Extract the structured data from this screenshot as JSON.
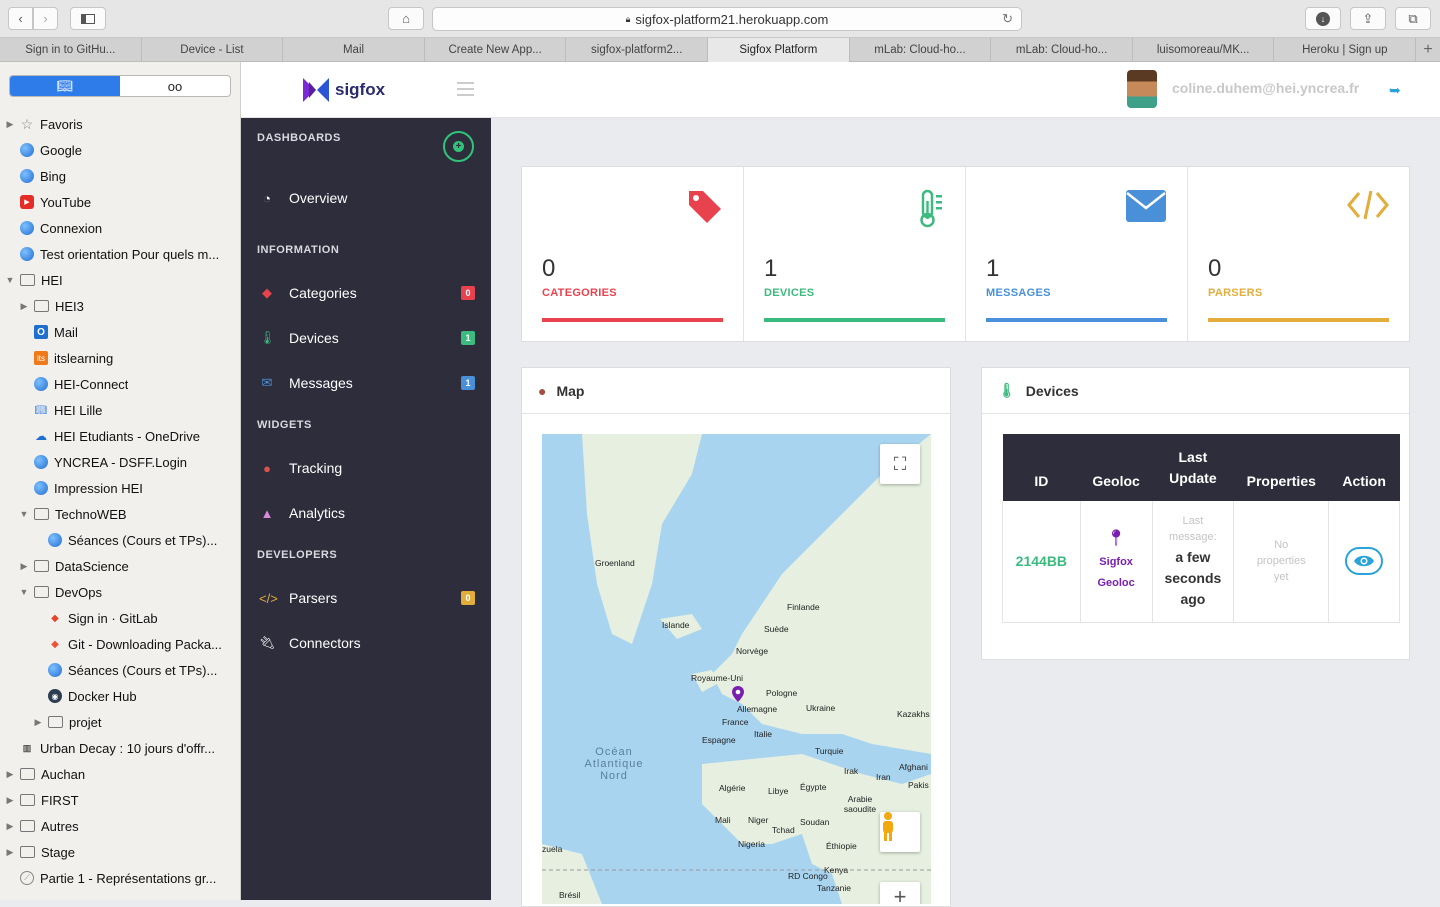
{
  "browser": {
    "url": "sigfox-platform21.herokuapp.com",
    "tabs": [
      "Sign in to GitHu...",
      "Device - List",
      "Mail",
      "Create New App...",
      "sigfox-platform2...",
      "Sigfox Platform",
      "mLab: Cloud-ho...",
      "mLab: Cloud-ho...",
      "luisomoreau/MK...",
      "Heroku | Sign up"
    ],
    "active_tab": 5
  },
  "bookmarks": [
    {
      "label": "Favoris",
      "icon": "star",
      "level": 0,
      "arrow": "▶"
    },
    {
      "label": "Google",
      "icon": "globe",
      "level": 0,
      "arrow": ""
    },
    {
      "label": "Bing",
      "icon": "globe",
      "level": 0,
      "arrow": ""
    },
    {
      "label": "YouTube",
      "icon": "youtube",
      "level": 0,
      "arrow": ""
    },
    {
      "label": "Connexion",
      "icon": "globe",
      "level": 0,
      "arrow": ""
    },
    {
      "label": "Test orientation Pour quels m...",
      "icon": "globe",
      "level": 0,
      "arrow": ""
    },
    {
      "label": "HEI",
      "icon": "folder",
      "level": 0,
      "arrow": "▼"
    },
    {
      "label": "HEI3",
      "icon": "folder",
      "level": 1,
      "arrow": "▶"
    },
    {
      "label": "Mail",
      "icon": "outlook",
      "level": 1,
      "arrow": ""
    },
    {
      "label": "itslearning",
      "icon": "its",
      "level": 1,
      "arrow": ""
    },
    {
      "label": "HEI-Connect",
      "icon": "globe",
      "level": 1,
      "arrow": ""
    },
    {
      "label": "HEI Lille",
      "icon": "book",
      "level": 1,
      "arrow": ""
    },
    {
      "label": "HEI Etudiants - OneDrive",
      "icon": "cloud",
      "level": 1,
      "arrow": ""
    },
    {
      "label": "YNCREA - DSFF.Login",
      "icon": "globe",
      "level": 1,
      "arrow": ""
    },
    {
      "label": "Impression HEI",
      "icon": "globe",
      "level": 1,
      "arrow": ""
    },
    {
      "label": "TechnoWEB",
      "icon": "folder",
      "level": 1,
      "arrow": "▼"
    },
    {
      "label": "Séances (Cours et TPs)...",
      "icon": "globe",
      "level": 2,
      "arrow": ""
    },
    {
      "label": "DataScience",
      "icon": "folder",
      "level": 1,
      "arrow": "▶"
    },
    {
      "label": "DevOps",
      "icon": "folder",
      "level": 1,
      "arrow": "▼"
    },
    {
      "label": "Sign in · GitLab",
      "icon": "gitlab",
      "level": 2,
      "arrow": ""
    },
    {
      "label": "Git - Downloading Packa...",
      "icon": "git",
      "level": 2,
      "arrow": ""
    },
    {
      "label": "Séances (Cours et TPs)...",
      "icon": "globe",
      "level": 2,
      "arrow": ""
    },
    {
      "label": "Docker Hub",
      "icon": "docker",
      "level": 2,
      "arrow": ""
    },
    {
      "label": "projet",
      "icon": "folder",
      "level": 2,
      "arrow": "▶"
    },
    {
      "label": "Urban Decay : 10 jours d'offr...",
      "icon": "urban",
      "level": 0,
      "arrow": ""
    },
    {
      "label": "Auchan",
      "icon": "folder",
      "level": 0,
      "arrow": "▶"
    },
    {
      "label": "FIRST",
      "icon": "folder",
      "level": 0,
      "arrow": "▶"
    },
    {
      "label": "Autres",
      "icon": "folder",
      "level": 0,
      "arrow": "▶"
    },
    {
      "label": "Stage",
      "icon": "folder",
      "level": 0,
      "arrow": "▶"
    },
    {
      "label": "Partie 1 - Représentations gr...",
      "icon": "compass",
      "level": 0,
      "arrow": ""
    }
  ],
  "header": {
    "brand": "sigfox",
    "user_email": "coline.duhem@hei.yncrea.fr"
  },
  "nav": {
    "dashboards": "DASHBOARDS",
    "overview": "Overview",
    "information": "INFORMATION",
    "categories": "Categories",
    "categories_count": "0",
    "devices": "Devices",
    "devices_count": "1",
    "messages": "Messages",
    "messages_count": "1",
    "widgets": "WIDGETS",
    "tracking": "Tracking",
    "analytics": "Analytics",
    "developers": "DEVELOPERS",
    "parsers": "Parsers",
    "parsers_count": "0",
    "connectors": "Connectors"
  },
  "stats": {
    "categories": {
      "value": "0",
      "label": "CATEGORIES",
      "color": "#e8424f"
    },
    "devices": {
      "value": "1",
      "label": "DEVICES",
      "color": "#3dba7f"
    },
    "messages": {
      "value": "1",
      "label": "MESSAGES",
      "color": "#4a90d9"
    },
    "parsers": {
      "value": "0",
      "label": "PARSERS",
      "color": "#e2ad3b"
    }
  },
  "map_panel": {
    "title": "Map",
    "labels": [
      "Groenland",
      "Islande",
      "Finlande",
      "Suède",
      "Norvège",
      "Royaume-Uni",
      "Pologne",
      "Allemagne",
      "Ukraine",
      "Kazakhs",
      "France",
      "Italie",
      "Espagne",
      "Turquie",
      "Océan Atlantique Nord",
      "Irak",
      "Iran",
      "Afghani",
      "Pakis",
      "Algérie",
      "Libye",
      "Égypte",
      "Arabie saoudite",
      "Mali",
      "Niger",
      "Tchad",
      "Soudan",
      "Éthiopie",
      "Nigeria",
      "zuela",
      "Kenya",
      "RD Congo",
      "Tanzanie",
      "Brésil"
    ]
  },
  "devices_panel": {
    "title": "Devices",
    "columns": [
      "ID",
      "Geoloc",
      "Last Update",
      "Properties",
      "Action"
    ],
    "rows": [
      {
        "id": "2144BB",
        "geoloc": "Sigfox Geoloc",
        "last_caption": "Last message:",
        "last_value": "a few seconds ago",
        "properties": "No properties yet"
      }
    ]
  }
}
